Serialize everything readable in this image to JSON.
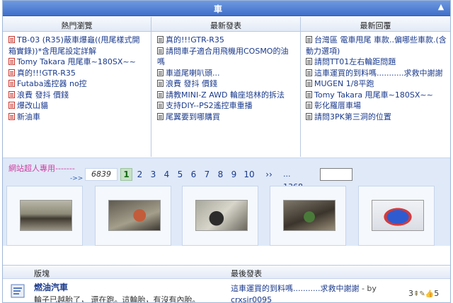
{
  "panel": {
    "title": "車",
    "collapse_icon": "▲"
  },
  "columns": [
    {
      "header": "熱門瀏覽",
      "items": [
        {
          "text": "TB-03 (R35)蔽車爆龜((甩尾樣式開箱實錄))*含甩尾設定詳解",
          "red": false
        },
        {
          "text": "Tomy Takara 甩尾車~180SX~~",
          "red": false
        },
        {
          "text": "真的!!!GTR-R35",
          "red": false
        },
        {
          "text": "Futaba遙控器 no控",
          "red": false
        },
        {
          "text": "浪費 發抖 價錢",
          "red": false
        },
        {
          "text": "爆改山貓",
          "red": false
        },
        {
          "text": "新油車",
          "red": false
        }
      ]
    },
    {
      "header": "最新發表",
      "items": [
        {
          "text": "真的!!!GTR-R35"
        },
        {
          "text": "請問車子適合用飛機用COSMO的油嗎"
        },
        {
          "text": "車道尾喇叭頭..."
        },
        {
          "text": "浪費 發抖 價錢"
        },
        {
          "text": "請教MINI-Z AWD 輪座培林的拆法"
        },
        {
          "text": "支持DIY--PS2遙控車重播"
        },
        {
          "text": "尾翼要到哪購買"
        }
      ]
    },
    {
      "header": "最新回覆",
      "items": [
        {
          "text": "台灣區 電車甩尾 車款..偏哪些車款.(含動力選項)"
        },
        {
          "text": "請問TT01左右輪距問題"
        },
        {
          "text": "這車運買的到料嗎...........求救中謝謝"
        },
        {
          "text": "MUGEN 1/8平跑"
        },
        {
          "text": "Tomy Takara 甩尾車~180SX~~"
        },
        {
          "text": "彰化羅厝車場"
        },
        {
          "text": "請問3PK第三洞的位置"
        }
      ]
    }
  ],
  "promo": {
    "text": "網站超人專用-------",
    "arrows": "->>"
  },
  "pagination": {
    "total": "6839",
    "current": "1",
    "pages": [
      "1",
      "2",
      "3",
      "4",
      "5",
      "6",
      "7",
      "8",
      "9",
      "10"
    ],
    "next": "››",
    "last": "... 1368"
  },
  "gallery": [
    "thumb-1",
    "thumb-2",
    "thumb-3",
    "thumb-4",
    "thumb-5"
  ],
  "forum_table": {
    "header_forum": "版塊",
    "header_last": "最後發表",
    "row": {
      "name": "燃油汽車",
      "description": "輪子已越胎了， 還在跑。這輪胎，有沒有內胎。",
      "last_post_title": "這車運買的到料嗎...........求救中謝謝",
      "last_post_by": " - by",
      "last_post_user": "crxsir0095",
      "stats_text": "3",
      "stats_extra": "5"
    }
  }
}
